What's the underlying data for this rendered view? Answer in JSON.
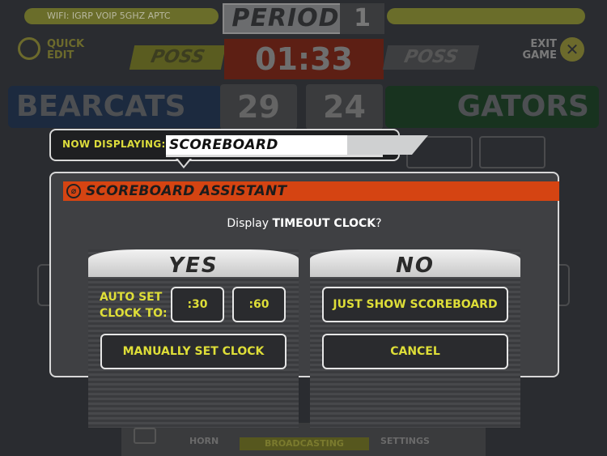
{
  "background": {
    "wifi": "WIFI: IGRP VOIP 5GHZ APTC",
    "period_label": "PERIOD",
    "period_number": "1",
    "quick_edit": "QUICK EDIT",
    "exit_game": "EXIT GAME",
    "poss_left": "POSS",
    "poss_right": "POSS",
    "clock": "01:33",
    "home_team": "BEARCATS",
    "home_score": "29",
    "away_score": "24",
    "away_team": "GATORS",
    "bottom": {
      "horn": "HORN",
      "broadcasting": "BROADCASTING",
      "settings": "SETTINGS"
    }
  },
  "now_displaying": {
    "label": "NOW DISPLAYING:",
    "value": "SCOREBOARD"
  },
  "dialog": {
    "title": "SCOREBOARD ASSISTANT",
    "prompt_prefix": "Display ",
    "prompt_bold": "TIMEOUT CLOCK",
    "prompt_suffix": "?",
    "yes": {
      "label": "YES",
      "auto_set_line1": "AUTO SET",
      "auto_set_line2": "CLOCK TO:",
      "opt_30": ":30",
      "opt_60": ":60",
      "manual": "MANUALLY SET CLOCK"
    },
    "no": {
      "label": "NO",
      "just_show": "JUST SHOW SCOREBOARD",
      "cancel": "CANCEL"
    }
  },
  "colors": {
    "accent_orange": "#d54412",
    "accent_yellow": "#dede38"
  }
}
